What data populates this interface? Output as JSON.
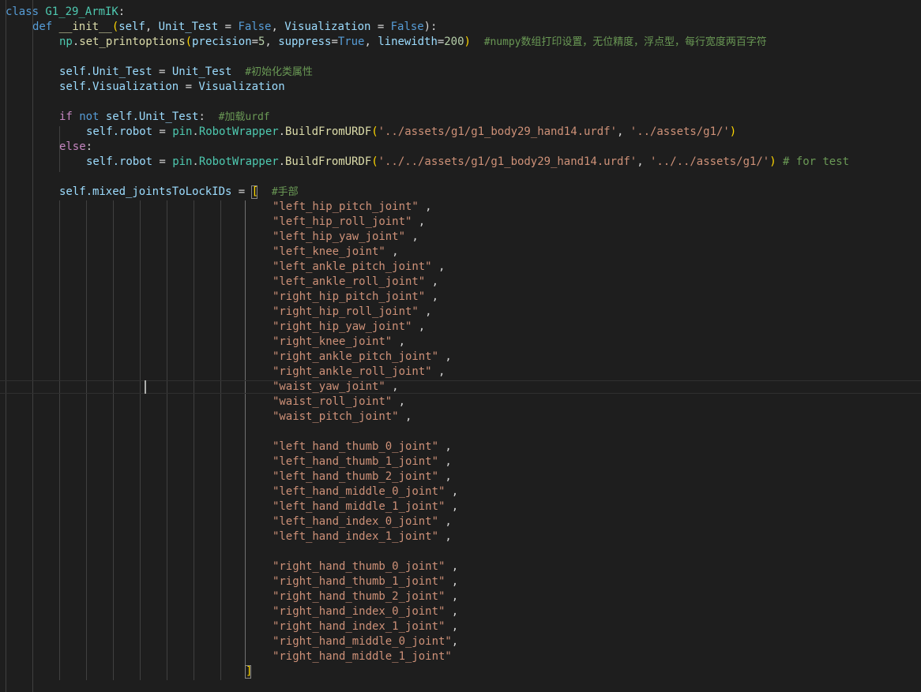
{
  "code": {
    "class_kw": "class",
    "class_name": "G1_29_ArmIK",
    "colon": ":",
    "def_kw": "def",
    "init_name": "__init__",
    "init_params": {
      "open": "(",
      "self": "self",
      "comma1": ", ",
      "p1": "Unit_Test",
      "eq1": " = ",
      "v1": "False",
      "comma2": ", ",
      "p2": "Visualization",
      "eq2": " = ",
      "v2": "False",
      "close": "):"
    },
    "printopt": {
      "mod": "np",
      "dot": ".",
      "fn": "set_printoptions",
      "open": "(",
      "k1": "precision",
      "eq1": "=",
      "v1": "5",
      "c1": ", ",
      "k2": "suppress",
      "eq2": "=",
      "v2": "True",
      "c2": ", ",
      "k3": "linewidth",
      "eq3": "=",
      "v3": "200",
      "close": ")",
      "comment": "#numpy数组打印设置，无位精度，浮点型，每行宽度两百字符"
    },
    "assign_unit": {
      "self": "self",
      "attr": ".Unit_Test",
      "eq": " = ",
      "val": "Unit_Test",
      "comment": "#初始化类属性"
    },
    "assign_vis": {
      "self": "self",
      "attr": ".Visualization",
      "eq": " = ",
      "val": "Visualization"
    },
    "if_line": {
      "if_kw": "if",
      "not_kw": "not",
      "self": "self",
      "attr": ".Unit_Test",
      "colon": ":",
      "comment": "#加载urdf"
    },
    "robot1": {
      "self": "self",
      "attr": ".robot",
      "eq": " = ",
      "mod": "pin",
      "cls": "RobotWrapper",
      "fn": "BuildFromURDF",
      "open": "(",
      "s1": "'../assets/g1/g1_body29_hand14.urdf'",
      "comma": ", ",
      "s2": "'../assets/g1/'",
      "close": ")"
    },
    "else_kw": "else",
    "robot2": {
      "self": "self",
      "attr": ".robot",
      "eq": " = ",
      "mod": "pin",
      "cls": "RobotWrapper",
      "fn": "BuildFromURDF",
      "open": "(",
      "s1": "'../../assets/g1/g1_body29_hand14.urdf'",
      "comma": ", ",
      "s2": "'../../assets/g1/'",
      "close": ")",
      "comment": "# for test"
    },
    "mixed": {
      "self": "self",
      "attr": ".mixed_jointsToLockIDs",
      "eq": " = ",
      "open": "[",
      "comment": "#手部"
    },
    "joints_body": [
      {
        "name": "\"left_hip_pitch_joint\"",
        "sep": " ,"
      },
      {
        "name": "\"left_hip_roll_joint\"",
        "sep": " ,"
      },
      {
        "name": "\"left_hip_yaw_joint\"",
        "sep": " ,"
      },
      {
        "name": "\"left_knee_joint\"",
        "sep": " ,"
      },
      {
        "name": "\"left_ankle_pitch_joint\"",
        "sep": " ,"
      },
      {
        "name": "\"left_ankle_roll_joint\"",
        "sep": " ,"
      },
      {
        "name": "\"right_hip_pitch_joint\"",
        "sep": " ,"
      },
      {
        "name": "\"right_hip_roll_joint\"",
        "sep": " ,"
      },
      {
        "name": "\"right_hip_yaw_joint\"",
        "sep": " ,"
      },
      {
        "name": "\"right_knee_joint\"",
        "sep": " ,"
      },
      {
        "name": "\"right_ankle_pitch_joint\"",
        "sep": " ,"
      },
      {
        "name": "\"right_ankle_roll_joint\"",
        "sep": " ,"
      },
      {
        "name": "\"waist_yaw_joint\"",
        "sep": " ,"
      },
      {
        "name": "\"waist_roll_joint\"",
        "sep": " ,"
      },
      {
        "name": "\"waist_pitch_joint\"",
        "sep": " ,"
      }
    ],
    "joints_left_hand": [
      {
        "name": "\"left_hand_thumb_0_joint\"",
        "sep": " ,"
      },
      {
        "name": "\"left_hand_thumb_1_joint\"",
        "sep": " ,"
      },
      {
        "name": "\"left_hand_thumb_2_joint\"",
        "sep": " ,"
      },
      {
        "name": "\"left_hand_middle_0_joint\"",
        "sep": " ,"
      },
      {
        "name": "\"left_hand_middle_1_joint\"",
        "sep": " ,"
      },
      {
        "name": "\"left_hand_index_0_joint\"",
        "sep": " ,"
      },
      {
        "name": "\"left_hand_index_1_joint\"",
        "sep": " ,"
      }
    ],
    "joints_right_hand": [
      {
        "name": "\"right_hand_thumb_0_joint\"",
        "sep": " ,"
      },
      {
        "name": "\"right_hand_thumb_1_joint\"",
        "sep": " ,"
      },
      {
        "name": "\"right_hand_thumb_2_joint\"",
        "sep": " ,"
      },
      {
        "name": "\"right_hand_index_0_joint\"",
        "sep": " ,"
      },
      {
        "name": "\"right_hand_index_1_joint\"",
        "sep": " ,"
      },
      {
        "name": "\"right_hand_middle_0_joint\"",
        "sep": ","
      },
      {
        "name": "\"right_hand_middle_1_joint\"",
        "sep": ""
      }
    ],
    "close_bracket": "]"
  },
  "colors": {
    "background": "#1e1e1e",
    "keyword": "#569cd6",
    "control": "#c586c0",
    "class": "#4ec9b0",
    "function": "#dcdcaa",
    "variable": "#9cdcfe",
    "string": "#ce9178",
    "number": "#b5cea8",
    "comment": "#6a9955",
    "bracket": "#ffd700"
  }
}
